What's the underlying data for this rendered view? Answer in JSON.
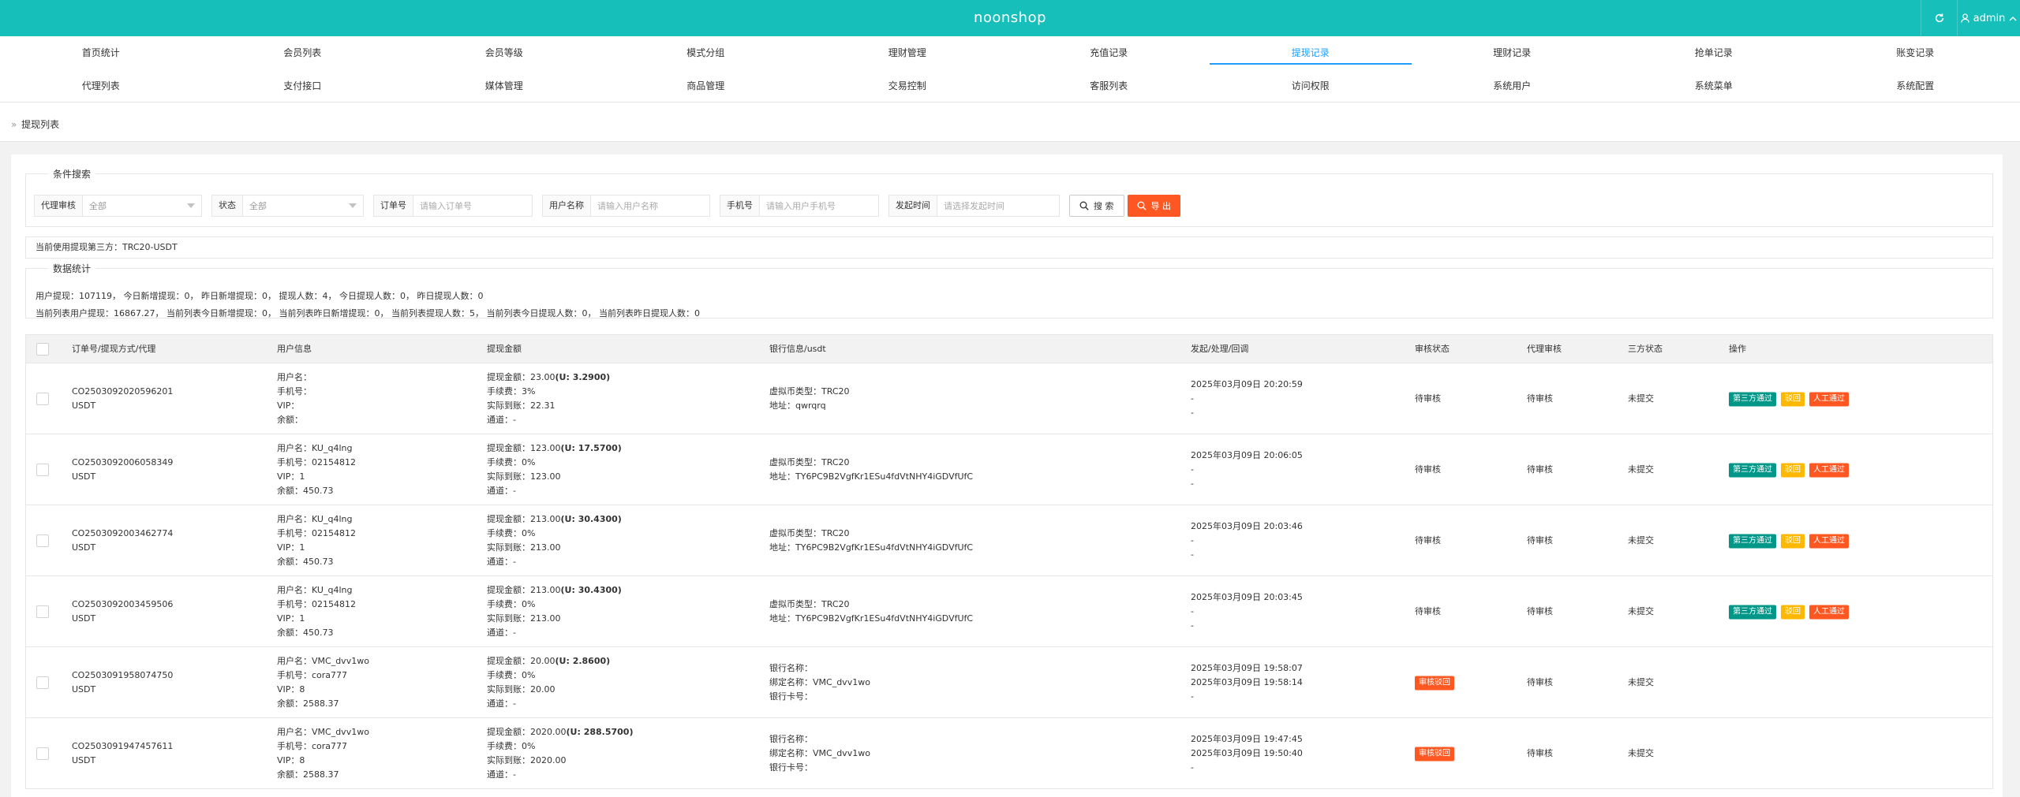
{
  "header": {
    "brand": "noonshop",
    "user": "admin"
  },
  "nav": {
    "row1": [
      "首页统计",
      "会员列表",
      "会员等级",
      "模式分组",
      "理财管理",
      "充值记录",
      "提现记录",
      "理财记录",
      "抢单记录",
      "账变记录"
    ],
    "row2": [
      "代理列表",
      "支付接口",
      "媒体管理",
      "商品管理",
      "交易控制",
      "客服列表",
      "访问权限",
      "系统用户",
      "系统菜单",
      "系统配置"
    ],
    "active": "提现记录"
  },
  "breadcrumb": {
    "title": "提现列表"
  },
  "search": {
    "legend": "条件搜索",
    "agent_review": {
      "label": "代理审核",
      "value": "全部"
    },
    "status": {
      "label": "状态",
      "value": "全部"
    },
    "order_no": {
      "label": "订单号",
      "placeholder": "请输入订单号"
    },
    "username": {
      "label": "用户名称",
      "placeholder": "请输入用户名称"
    },
    "phone": {
      "label": "手机号",
      "placeholder": "请输入用户手机号"
    },
    "time": {
      "label": "发起时间",
      "placeholder": "请选择发起时间"
    },
    "search_btn": "搜 索",
    "export_btn": "导 出"
  },
  "provider_text": "当前使用提现第三方：TRC20-USDT",
  "stats": {
    "legend": "数据统计",
    "line1": "用户提现：107119，  今日新增提现：0，  昨日新增提现：0，  提现人数：4，  今日提现人数：0，  昨日提现人数：0",
    "line2": "当前列表用户提现：16867.27，  当前列表今日新增提现：0，  当前列表昨日新增提现：0，  当前列表提现人数：5，  当前列表今日提现人数：0，  当前列表昨日提现人数：0"
  },
  "table": {
    "headers": [
      "订单号/提现方式/代理",
      "用户信息",
      "提现金额",
      "银行信息/usdt",
      "发起/处理/回调",
      "审核状态",
      "代理审核",
      "三方状态",
      "操作"
    ],
    "buttons": {
      "third_pass": "第三方通过",
      "reject": "驳回",
      "manual_pass": "人工通过"
    },
    "rows": [
      {
        "order": "CO2503092020596201",
        "method": "USDT",
        "user": [
          "用户名：",
          "手机号：",
          "VIP：",
          "余额："
        ],
        "amount": "提现金额：23.00",
        "amount_u": "(U: 3.2900)",
        "fee": "手续费：3%",
        "actual": "实际到账：22.31",
        "channel": "通道：-",
        "bank": [
          "虚拟币类型：TRC20",
          "地址：qwrqrq"
        ],
        "times": [
          "2025年03月09日 20:20:59",
          "-",
          "-"
        ],
        "review": "待审核",
        "review_tag": false,
        "agent": "待审核",
        "third": "未提交",
        "actions": true
      },
      {
        "order": "CO2503092006058349",
        "method": "USDT",
        "user": [
          "用户名：KU_q4lng",
          "手机号：02154812",
          "VIP：1",
          "余额：450.73"
        ],
        "amount": "提现金额：123.00",
        "amount_u": "(U: 17.5700)",
        "fee": "手续费：0%",
        "actual": "实际到账：123.00",
        "channel": "通道：-",
        "bank": [
          "虚拟币类型：TRC20",
          "地址：TY6PC9B2VgfKr1ESu4fdVtNHY4iGDVfUfC"
        ],
        "times": [
          "2025年03月09日 20:06:05",
          "-",
          "-"
        ],
        "review": "待审核",
        "review_tag": false,
        "agent": "待审核",
        "third": "未提交",
        "actions": true
      },
      {
        "order": "CO2503092003462774",
        "method": "USDT",
        "user": [
          "用户名：KU_q4lng",
          "手机号：02154812",
          "VIP：1",
          "余额：450.73"
        ],
        "amount": "提现金额：213.00",
        "amount_u": "(U: 30.4300)",
        "fee": "手续费：0%",
        "actual": "实际到账：213.00",
        "channel": "通道：-",
        "bank": [
          "虚拟币类型：TRC20",
          "地址：TY6PC9B2VgfKr1ESu4fdVtNHY4iGDVfUfC"
        ],
        "times": [
          "2025年03月09日 20:03:46",
          "-",
          "-"
        ],
        "review": "待审核",
        "review_tag": false,
        "agent": "待审核",
        "third": "未提交",
        "actions": true
      },
      {
        "order": "CO2503092003459506",
        "method": "USDT",
        "user": [
          "用户名：KU_q4lng",
          "手机号：02154812",
          "VIP：1",
          "余额：450.73"
        ],
        "amount": "提现金额：213.00",
        "amount_u": "(U: 30.4300)",
        "fee": "手续费：0%",
        "actual": "实际到账：213.00",
        "channel": "通道：-",
        "bank": [
          "虚拟币类型：TRC20",
          "地址：TY6PC9B2VgfKr1ESu4fdVtNHY4iGDVfUfC"
        ],
        "times": [
          "2025年03月09日 20:03:45",
          "-",
          "-"
        ],
        "review": "待审核",
        "review_tag": false,
        "agent": "待审核",
        "third": "未提交",
        "actions": true
      },
      {
        "order": "CO2503091958074750",
        "method": "USDT",
        "user": [
          "用户名：VMC_dvv1wo",
          "手机号：cora777",
          "VIP：8",
          "余额：2588.37"
        ],
        "amount": "提现金额：20.00",
        "amount_u": "(U: 2.8600)",
        "fee": "手续费：0%",
        "actual": "实际到账：20.00",
        "channel": "通道：-",
        "bank": [
          "银行名称：",
          "绑定名称：VMC_dvv1wo",
          "银行卡号："
        ],
        "times": [
          "2025年03月09日 19:58:07",
          "2025年03月09日 19:58:14",
          "-"
        ],
        "review": "审核驳回",
        "review_tag": true,
        "agent": "待审核",
        "third": "未提交",
        "actions": false
      },
      {
        "order": "CO2503091947457611",
        "method": "USDT",
        "user": [
          "用户名：VMC_dvv1wo",
          "手机号：cora777",
          "VIP：8",
          "余额：2588.37"
        ],
        "amount": "提现金额：2020.00",
        "amount_u": "(U: 288.5700)",
        "fee": "手续费：0%",
        "actual": "实际到账：2020.00",
        "channel": "通道：-",
        "bank": [
          "银行名称：",
          "绑定名称：VMC_dvv1wo",
          "银行卡号："
        ],
        "times": [
          "2025年03月09日 19:47:45",
          "2025年03月09日 19:50:40",
          "-"
        ],
        "review": "审核驳回",
        "review_tag": true,
        "agent": "待审核",
        "third": "未提交",
        "actions": false
      }
    ]
  },
  "colors": {
    "header": "#16bfb9",
    "active_nav": "#1e9fff",
    "green": "#009688",
    "yellow": "#ffb800",
    "orange": "#ff5722"
  },
  "icons": {
    "refresh": "refresh-icon",
    "user": "user-icon",
    "collapse": "chevron-up-icon",
    "search": "search-icon",
    "export": "export-icon"
  }
}
